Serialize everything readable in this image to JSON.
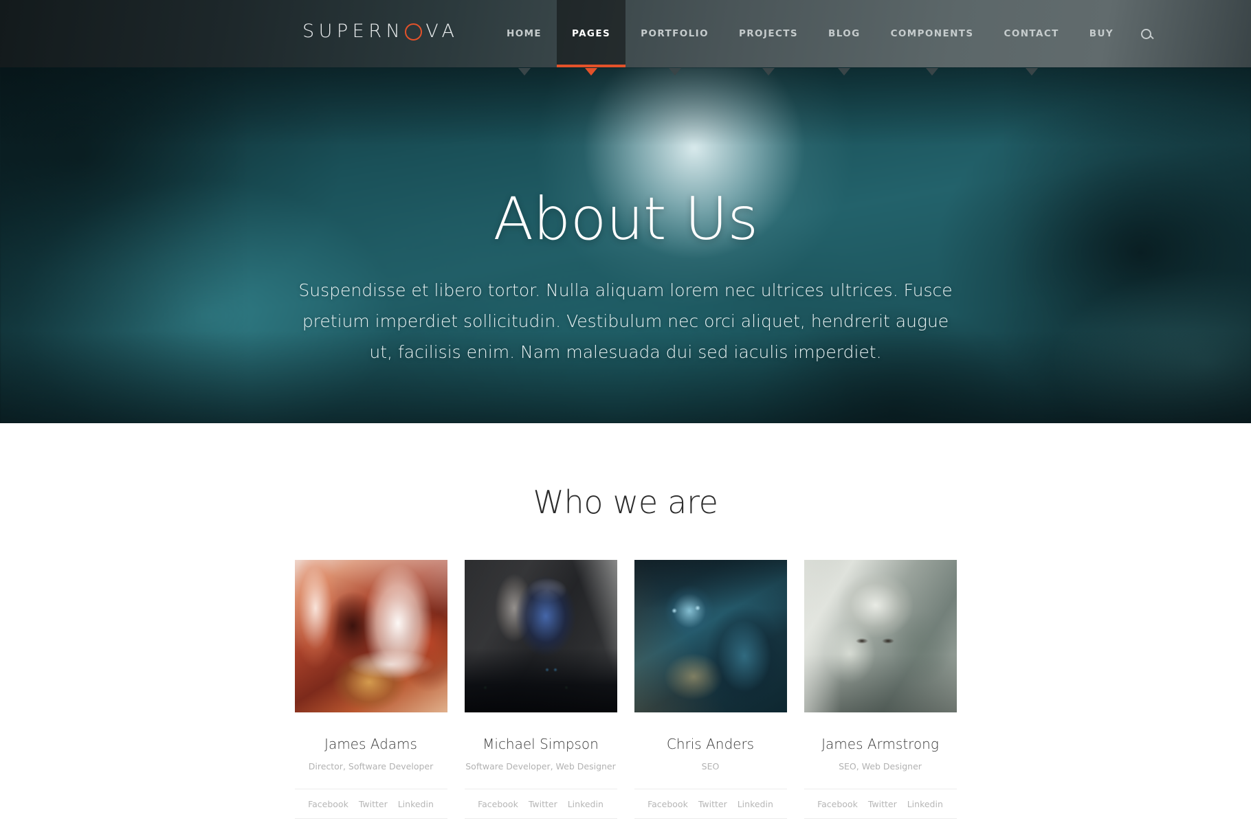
{
  "brand": {
    "name_part_a": "SUPERN",
    "name_ring_letter": "O",
    "name_part_b": "VA",
    "full_name": "SUPERNOVA",
    "accent_color": "#e3522a"
  },
  "nav": {
    "items": [
      {
        "label": "HOME",
        "active": false,
        "has_caret": true
      },
      {
        "label": "PAGES",
        "active": true,
        "has_caret": true
      },
      {
        "label": "PORTFOLIO",
        "active": false,
        "has_caret": true
      },
      {
        "label": "PROJECTS",
        "active": false,
        "has_caret": true
      },
      {
        "label": "BLOG",
        "active": false,
        "has_caret": true
      },
      {
        "label": "COMPONENTS",
        "active": false,
        "has_caret": true
      },
      {
        "label": "CONTACT",
        "active": false,
        "has_caret": true
      },
      {
        "label": "BUY",
        "active": false,
        "has_caret": false
      }
    ],
    "search_icon": "search-icon"
  },
  "hero": {
    "title": "About Us",
    "subtitle": "Suspendisse et libero tortor. Nulla aliquam lorem nec ultrices ultrices. Fusce pretium imperdiet sollicitudin. Vestibulum nec orci aliquet, hendrerit augue ut, facilisis enim. Nam malesuada dui sed iaculis imperdiet.",
    "background_color": "#1d555d"
  },
  "team_section": {
    "title": "Who we are",
    "social_labels": {
      "facebook": "Facebook",
      "twitter": "Twitter",
      "linkedin": "Linkedin"
    },
    "members": [
      {
        "name": "James Adams",
        "role": "Director, Software Developer",
        "photo": "fiery-warrior-portrait",
        "social": [
          "Facebook",
          "Twitter",
          "Linkedin"
        ]
      },
      {
        "name": "Michael Simpson",
        "role": "Software Developer, Web Designer",
        "photo": "sci-fi-robot-portrait",
        "social": [
          "Facebook",
          "Twitter",
          "Linkedin"
        ]
      },
      {
        "name": "Chris Anders",
        "role": "SEO",
        "photo": "horned-demon-portrait",
        "social": [
          "Facebook",
          "Twitter",
          "Linkedin"
        ]
      },
      {
        "name": "James Armstrong",
        "role": "SEO, Web Designer",
        "photo": "armored-knight-portrait",
        "social": [
          "Facebook",
          "Twitter",
          "Linkedin"
        ]
      }
    ]
  }
}
